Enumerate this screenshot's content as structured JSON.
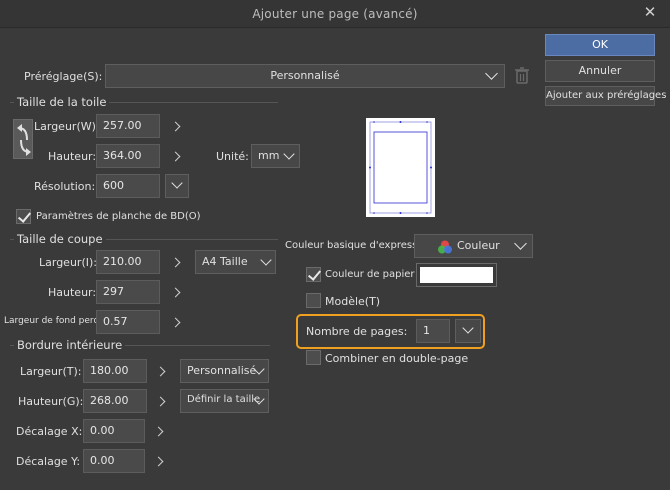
{
  "window": {
    "title": "Ajouter une page (avancé)",
    "close_glyph": "✕"
  },
  "buttons": {
    "ok": "OK",
    "cancel": "Annuler",
    "add_preset": "Ajouter aux préréglages"
  },
  "preset": {
    "label": "Préréglage(S):",
    "value": "Personnalisé"
  },
  "canvas_size": {
    "title": "Taille de la toile",
    "width_label": "Largeur(W):",
    "width_value": "257.00",
    "height_label": "Hauteur:",
    "height_value": "364.00",
    "unit_label": "Unité:",
    "unit_value": "mm",
    "resolution_label": "Résolution:",
    "resolution_value": "600",
    "comic_settings_label": "Paramètres de planche de BD(O)",
    "comic_settings_checked": true
  },
  "crop_size": {
    "title": "Taille de coupe",
    "width_label": "Largeur(I):",
    "width_value": "210.00",
    "height_label": "Hauteur:",
    "height_value": "297",
    "bleed_label": "Largeur de fond perdu",
    "bleed_value": "0.57",
    "size_preset": "A4 Taille"
  },
  "inner_border": {
    "title": "Bordure intérieure",
    "width_label": "Largeur(T):",
    "width_value": "180.00",
    "width_preset": "Personnalisé",
    "height_label": "Hauteur(G):",
    "height_value": "268.00",
    "height_preset": "Définir la taille",
    "offset_x_label": "Décalage X:",
    "offset_x_value": "0.00",
    "offset_y_label": "Décalage Y:",
    "offset_y_value": "0.00"
  },
  "expression": {
    "label": "Couleur basique d'expression:",
    "value": "Couleur"
  },
  "paper_color": {
    "label": "Couleur de papier",
    "checked": true,
    "color": "#ffffff"
  },
  "template": {
    "label": "Modèle(T)",
    "checked": false
  },
  "pages": {
    "label": "Nombre de pages:",
    "value": "1",
    "highlight_color": "#f0a020"
  },
  "spread": {
    "label": "Combiner en double-page",
    "checked": false
  }
}
